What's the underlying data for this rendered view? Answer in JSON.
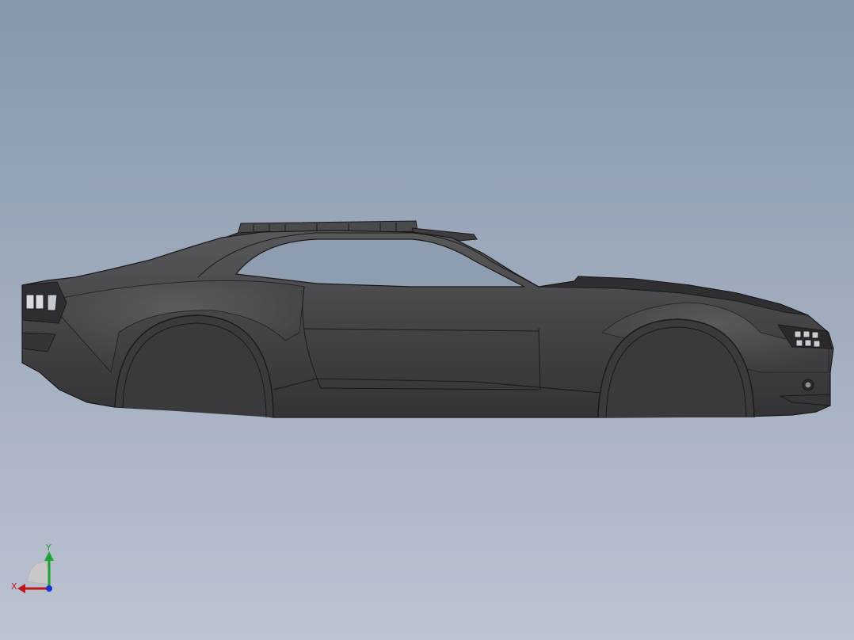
{
  "viewport": {
    "background_top": "#8697ac",
    "background_bottom": "#bcc3d1"
  },
  "model": {
    "body_color": "#3f3f41",
    "edge_color": "#1a1a1a"
  },
  "triad": {
    "x_label": "X",
    "y_label": "Y",
    "x_color": "#c0151b",
    "y_color": "#1ea237",
    "z_color": "#1a34d6"
  }
}
